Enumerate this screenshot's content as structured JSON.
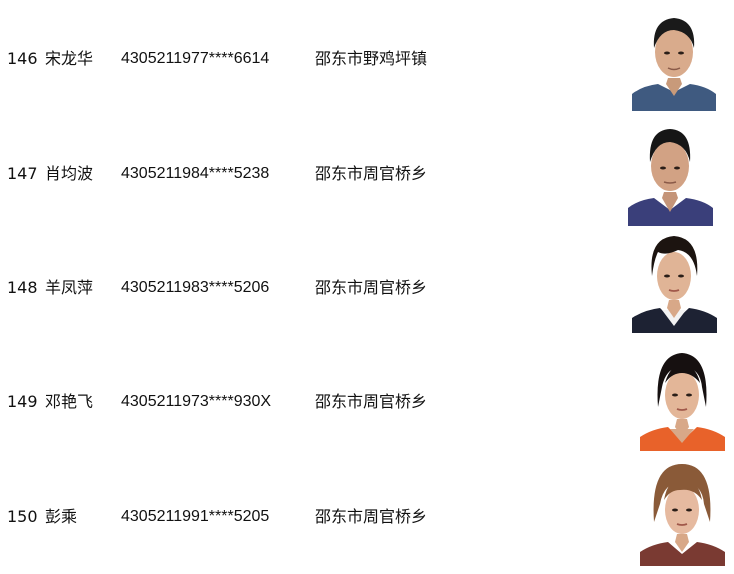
{
  "records": [
    {
      "number": "146",
      "name": "宋龙华",
      "id_number": "4305211977****6614",
      "address": "邵东市野鸡坪镇"
    },
    {
      "number": "147",
      "name": "肖均波",
      "id_number": "4305211984****5238",
      "address": "邵东市周官桥乡"
    },
    {
      "number": "148",
      "name": "羊凤萍",
      "id_number": "4305211983****5206",
      "address": "邵东市周官桥乡"
    },
    {
      "number": "149",
      "name": "邓艳飞",
      "id_number": "4305211973****930X",
      "address": "邵东市周官桥乡"
    },
    {
      "number": "150",
      "name": "彭乘",
      "id_number": "4305211991****5205",
      "address": "邵东市周官桥乡"
    }
  ]
}
